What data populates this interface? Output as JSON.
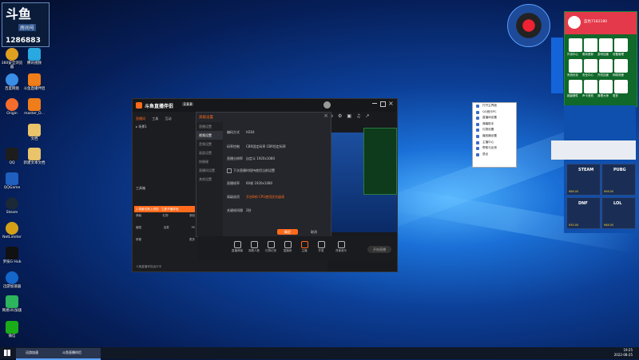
{
  "desktop": {
    "logo": {
      "brand": "斗鱼",
      "room_label": "房间号",
      "room_number": "1286883",
      "sub": "斗鱼直播"
    },
    "icons": [
      {
        "label": "360安全浏览器",
        "icon": "browser-360-icon",
        "color": "#e0a020"
      },
      {
        "label": "腾讯视频",
        "icon": "tencent-video-icon",
        "color": "#2aa8e0"
      },
      {
        "label": "百度网盘",
        "icon": "baidu-netdisk-icon",
        "color": "#3a8ee6"
      },
      {
        "label": "斗鱼直播伴侣",
        "icon": "douyu-companion-icon",
        "color": "#ef7d1a"
      },
      {
        "label": "Origin",
        "icon": "origin-icon",
        "color": "#f56c2d"
      },
      {
        "label": "master_D...",
        "icon": "master-icon",
        "color": "#ef7d1a"
      },
      {
        "label": "QQ",
        "icon": "qq-icon",
        "color": "#1d1d1d"
      },
      {
        "label": "WeGame",
        "icon": "wegame-icon",
        "color": "#ffcc33"
      },
      {
        "label": "文档",
        "icon": "folder-icon",
        "color": "#e9c46a"
      },
      {
        "label": "QQGame",
        "icon": "qqgame-icon",
        "color": "#1f5fbf"
      },
      {
        "label": "新建文本文档",
        "icon": "folder-icon",
        "color": "#e9c46a"
      },
      {
        "label": "Steam",
        "icon": "steam-icon",
        "color": "#1b2838"
      },
      {
        "label": "NetLimiter",
        "icon": "netlimiter-icon",
        "color": "#d4a017"
      },
      {
        "label": "罗技G Hub",
        "icon": "logitech-icon",
        "color": "#111111"
      },
      {
        "label": "迅游加速器",
        "icon": "xunyou-icon",
        "color": "#1466c8"
      },
      {
        "label": "网易UU加速",
        "icon": "uu-icon",
        "color": "#2db55d"
      },
      {
        "label": "微信",
        "icon": "wechat-icon",
        "color": "#1aad19"
      }
    ]
  },
  "app": {
    "title": "斗鱼直播伴侣",
    "version": "2.8.8",
    "left_tabs": [
      "直播间",
      "工具",
      "互动"
    ],
    "scene_label": "场景1",
    "tools_title": "工具箱",
    "banner": "1 场景切换上线啦 · 立即开播体验",
    "tool_labels": [
      "弹幕",
      "礼物",
      "录制",
      "截图",
      "连麦",
      "PK",
      "房管",
      "更多"
    ],
    "status": "斗鱼直播伴侣运行中"
  },
  "dialog": {
    "title": "高级设置",
    "side_items": [
      "直播设置",
      "音频设置",
      "视频设置",
      "画面设置",
      "快捷键",
      "直播间设置",
      "其他设置"
    ],
    "active_item": "视频设置",
    "rows": [
      {
        "label": "编码方式",
        "value": "H264"
      },
      {
        "label": "码率控制",
        "value": "CBR固定码率 CBR恒定码率"
      },
      {
        "label": "直播分辨率",
        "value": "自定义 1920x1080"
      },
      {
        "label": "",
        "value": "下次直播时保持使用当前设置"
      },
      {
        "label": "直播帧率",
        "value": "60帧 1920x1080"
      },
      {
        "label": "高级选项",
        "value": "开启B帧 CPU使用优先级高"
      },
      {
        "label": "关键帧间隔",
        "value": "2秒"
      }
    ],
    "ok": "确定",
    "cancel": "取消"
  },
  "toolbar": {
    "items": [
      "直播弹幕",
      "观看人数",
      "礼物记录",
      "直播间",
      "主播",
      "开麦",
      "背景音乐"
    ],
    "start_button": "开始直播"
  },
  "context_menu": {
    "items": [
      "打开主界面",
      "QQ音乐PC",
      "直播间设置",
      "弹幕助手",
      "礼物设置",
      "播放器设置",
      "主播中心",
      "帮助与反馈",
      "退出"
    ]
  },
  "right_panel": {
    "user": "蓝色7182180",
    "grid_labels": [
      "外设中心",
      "驱动更新",
      "游戏加速",
      "设备管理",
      "系统优化",
      "安全中心",
      "开机加速",
      "网络测速",
      "超级硬件",
      "声卡音效",
      "清理大师",
      "更多"
    ],
    "promo": [
      {
        "title": "STEAM",
        "price": "¥86.00"
      },
      {
        "title": "PUBG",
        "price": "¥98.00"
      },
      {
        "title": "DNF",
        "price": "¥30.00"
      },
      {
        "title": "LOL",
        "price": "¥68.00"
      }
    ]
  },
  "taskbar": {
    "items": [
      "迅游加速",
      "斗鱼直播伴侣"
    ],
    "time": "19:25",
    "date": "2022-08-25"
  }
}
